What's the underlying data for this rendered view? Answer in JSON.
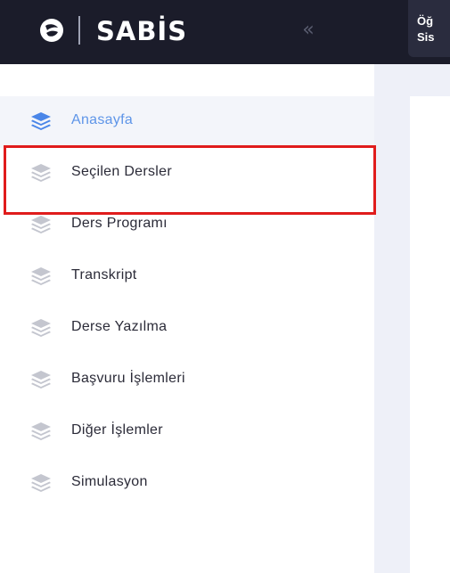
{
  "app": {
    "logo_text": "SABİS",
    "header_line1": "Öğ",
    "header_line2": "Sis"
  },
  "sidebar": {
    "items": [
      {
        "label": "Anasayfa",
        "icon": "layers-icon",
        "active": true
      },
      {
        "label": "Seçilen Dersler",
        "icon": "layers-icon",
        "active": false
      },
      {
        "label": "Ders Programı",
        "icon": "layers-icon",
        "active": false
      },
      {
        "label": "Transkript",
        "icon": "layers-icon",
        "active": false
      },
      {
        "label": "Derse Yazılma",
        "icon": "layers-icon",
        "active": false
      },
      {
        "label": "Başvuru İşlemleri",
        "icon": "layers-icon",
        "active": false
      },
      {
        "label": "Diğer İşlemler",
        "icon": "layers-icon",
        "active": false
      },
      {
        "label": "Simulasyon",
        "icon": "layers-icon",
        "active": false
      }
    ]
  },
  "colors": {
    "topbar": "#1b1c2a",
    "active_text": "#5e95e8",
    "active_icon": "#4a86e8",
    "inactive_icon": "#c4c6cf",
    "highlight_border": "#e01c1c"
  }
}
